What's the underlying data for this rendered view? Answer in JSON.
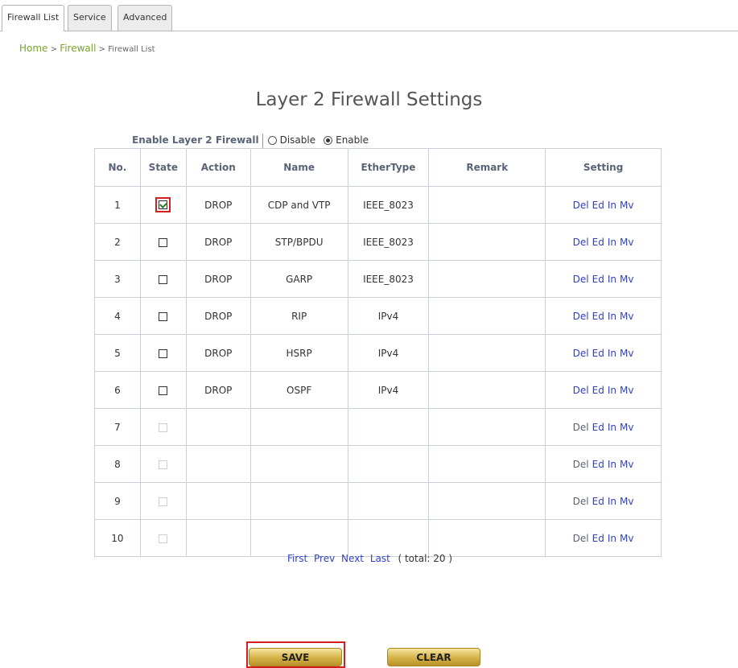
{
  "tabs": [
    {
      "label": "Firewall List",
      "active": true
    },
    {
      "label": "Service",
      "active": false
    },
    {
      "label": "Advanced",
      "active": false
    }
  ],
  "breadcrumb": {
    "home": "Home",
    "sep1": " > ",
    "section": "Firewall",
    "sep2": " > ",
    "current": "Firewall List"
  },
  "title": "Layer 2 Firewall Settings",
  "enable": {
    "label": "Enable Layer 2 Firewall",
    "options": [
      "Disable",
      "Enable"
    ],
    "selected": "Enable"
  },
  "table": {
    "headers": [
      "No.",
      "State",
      "Action",
      "Name",
      "EtherType",
      "Remark",
      "Setting"
    ],
    "rows": [
      {
        "no": "1",
        "state": "checked",
        "action": "DROP",
        "name": "CDP and VTP",
        "ethertype": "IEEE_8023",
        "remark": ""
      },
      {
        "no": "2",
        "state": "unchecked",
        "action": "DROP",
        "name": "STP/BPDU",
        "ethertype": "IEEE_8023",
        "remark": ""
      },
      {
        "no": "3",
        "state": "unchecked",
        "action": "DROP",
        "name": "GARP",
        "ethertype": "IEEE_8023",
        "remark": ""
      },
      {
        "no": "4",
        "state": "unchecked",
        "action": "DROP",
        "name": "RIP",
        "ethertype": "IPv4",
        "remark": ""
      },
      {
        "no": "5",
        "state": "unchecked",
        "action": "DROP",
        "name": "HSRP",
        "ethertype": "IPv4",
        "remark": ""
      },
      {
        "no": "6",
        "state": "unchecked",
        "action": "DROP",
        "name": "OSPF",
        "ethertype": "IPv4",
        "remark": ""
      },
      {
        "no": "7",
        "state": "disabled",
        "action": "",
        "name": "",
        "ethertype": "",
        "remark": ""
      },
      {
        "no": "8",
        "state": "disabled",
        "action": "",
        "name": "",
        "ethertype": "",
        "remark": ""
      },
      {
        "no": "9",
        "state": "disabled",
        "action": "",
        "name": "",
        "ethertype": "",
        "remark": ""
      },
      {
        "no": "10",
        "state": "disabled",
        "action": "",
        "name": "",
        "ethertype": "",
        "remark": ""
      }
    ],
    "setting_links": [
      "Del",
      "Ed",
      "In",
      "Mv"
    ]
  },
  "pager": {
    "first": "First",
    "prev": "Prev",
    "next": "Next",
    "last": "Last",
    "total": "( total: 20 )"
  },
  "buttons": {
    "save": "SAVE",
    "clear": "CLEAR"
  },
  "colors": {
    "link": "#3040c8",
    "breadcrumb": "#7aa42a",
    "header_text": "#5a6478",
    "highlight": "#d21e1e",
    "button_gold": "#d4b145"
  }
}
